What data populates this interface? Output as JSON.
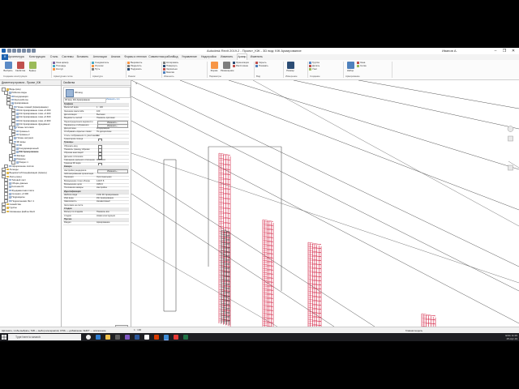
{
  "window": {
    "title": "Autodesk Revit 2019.2 - Проект_KЖ - 3D вид: КЖ Армирование",
    "user": "Иванов А.",
    "controls": [
      "–",
      "❐",
      "✕"
    ]
  },
  "ribbon_tabs": [
    "R",
    "Архитектура",
    "Конструкция",
    "Сталь",
    "Системы",
    "Вставить",
    "Аннотации",
    "Анализ",
    "Формы и генплан",
    "Совместная работа",
    "Вид",
    "Управление",
    "Надстройки",
    "Изменить",
    "Армир.",
    "Изменить"
  ],
  "ribbon_active_tab_index": 14,
  "ribbon": {
    "panels": [
      {
        "name": "Создание конструкции",
        "big": [
          "Выбрать",
          "Свойства",
          "Буфер"
        ]
      },
      {
        "name": "Арматурная сетка",
        "small": [
          "Зона армир.",
          "Площадь",
          "Контур"
        ]
      },
      {
        "name": "Арматура",
        "small": [
          "Соединитель",
          "Отрезок",
          "Путь"
        ]
      },
      {
        "name": "Режим",
        "small": [
          "Выровнять",
          "Разделить",
          "Подрезать"
        ]
      },
      {
        "name": "Изменить",
        "small": [
          "Копировать",
          "Повернуть",
          "Зеркально",
          "Массив"
        ]
      },
      {
        "name": "Параметры",
        "big": [
          "Форма",
          "Размещение"
        ],
        "small": [
          "Ориентация",
          "Расстояние"
        ]
      },
      {
        "name": "Вид",
        "small": [
          "Скрыть",
          "Показать"
        ]
      },
      {
        "name": "Измерение",
        "big": [
          "Размер"
        ]
      },
      {
        "name": "Создание",
        "small": [
          "Группа",
          "Деталь",
          "Узел"
        ]
      },
      {
        "name": "Армирование",
        "big": [
          "Набор"
        ],
        "small": [
          "Зона",
          "Сетка"
        ]
      }
    ]
  },
  "browser": {
    "title": "Диспетчер проекта - Проект_KЖ",
    "items": [
      {
        "label": "Виды (все)",
        "level": 0
      },
      {
        "label": "Рабочие виды",
        "level": 1
      },
      {
        "label": "Координация",
        "level": 2
      },
      {
        "label": "Железобетон",
        "level": 2
      },
      {
        "label": "Армирование",
        "level": 2
      },
      {
        "label": "Планы этажей (Армирование)",
        "level": 3
      },
      {
        "label": "КЖ Армирование этаж +0.000",
        "level": 4
      },
      {
        "label": "КЖ Армирование этаж +3.300",
        "level": 4
      },
      {
        "label": "КЖ Армирование этаж +6.600",
        "level": 4
      },
      {
        "label": "КЖ Армирование этаж +9.900",
        "level": 4
      },
      {
        "label": "КЖ Армирование фундамент",
        "level": 4
      },
      {
        "label": "Планы потолков",
        "level": 3
      },
      {
        "label": "Уровень 1",
        "level": 4
      },
      {
        "label": "Уровень 2",
        "level": 4
      },
      {
        "label": "Планы несущих",
        "level": 3
      },
      {
        "label": "3D виды",
        "level": 3
      },
      {
        "label": "3D",
        "level": 4
      },
      {
        "label": "Координационный",
        "level": 4
      },
      {
        "label": "КЖ Армирование",
        "level": 4,
        "selected": true
      },
      {
        "label": "Фасады",
        "level": 3
      },
      {
        "label": "Разрезы",
        "level": 3
      },
      {
        "label": "Разрез 1",
        "level": 4
      },
      {
        "label": "Оформление листов",
        "level": 1
      },
      {
        "label": "Легенды",
        "level": 0
      },
      {
        "label": "Ведомости/Спецификации (Армир.)",
        "level": 0
      },
      {
        "label": "Листы (все)",
        "level": 0
      },
      {
        "label": "Типовой лист",
        "level": 1
      },
      {
        "label": "Общие данные",
        "level": 1
      },
      {
        "label": "Колонна К1",
        "level": 1
      },
      {
        "label": "Фундаментная плита",
        "level": 1
      },
      {
        "label": "Сечения +3.300",
        "level": 1
      },
      {
        "label": "Подразделы",
        "level": 1
      },
      {
        "label": "Подколонники Лист 1",
        "level": 1
      },
      {
        "label": "Семейства",
        "level": 0
      },
      {
        "label": "Группы",
        "level": 0
      },
      {
        "label": "Связанные файлы Revit",
        "level": 0
      }
    ]
  },
  "properties": {
    "title": "Свойства",
    "type_icon": "3D-view-icon",
    "type_name": "3D вид",
    "type_dropdown": "3D вид: КЖ Армирование",
    "edit_type": "Изменить тип",
    "rows": [
      {
        "k": "Графика",
        "v": "",
        "section": true
      },
      {
        "k": "Масштаб вида",
        "v": "1 : 100"
      },
      {
        "k": "Значение масштаба",
        "v": "100"
      },
      {
        "k": "Детализация",
        "v": "Высокая"
      },
      {
        "k": "Видимость частей",
        "v": "Показать оригинал"
      },
      {
        "k": "Переопределения видимости",
        "v": "Изменить...",
        "button": true
      },
      {
        "k": "Параметры отображения",
        "v": "Изменить...",
        "button": true
      },
      {
        "k": "Дисциплина",
        "v": "Координация"
      },
      {
        "k": "Отображать скрытые линии",
        "v": "По дисциплине"
      },
      {
        "k": "Стиль отображения по умолчанию",
        "v": "Нет"
      },
      {
        "k": "Траектория солнца",
        "v": "",
        "checkbox": true
      },
      {
        "k": "Границы",
        "v": "",
        "section": true
      },
      {
        "k": "Обрезать вид",
        "v": "",
        "checkbox": true
      },
      {
        "k": "Показать границу обрезки",
        "v": "",
        "checkbox": true
      },
      {
        "k": "Обрезка аннотаций",
        "v": "",
        "checkbox": true
      },
      {
        "k": "Дальнее отсечение",
        "v": "",
        "checkbox": true
      },
      {
        "k": "Смещение дальнего отсечения",
        "v": "304800.0"
      },
      {
        "k": "Граница 3D вида",
        "v": "",
        "checkbox": true
      },
      {
        "k": "Камера",
        "v": "",
        "section": true
      },
      {
        "k": "Настройки рендеринга",
        "v": "Изменить...",
        "button": true
      },
      {
        "k": "Заблокированная ориентация",
        "v": ""
      },
      {
        "k": "Проекция",
        "v": "Ортогональная"
      },
      {
        "k": "Возвышение точки обзора",
        "v": "14167.8"
      },
      {
        "k": "Возвышение цели",
        "v": "4950.0"
      },
      {
        "k": "Положение камеры",
        "v": "Настройка"
      },
      {
        "k": "Идентификация",
        "v": "",
        "section": true
      },
      {
        "k": "Шаблон вида",
        "v": "3 КЖ 3D Армирование"
      },
      {
        "k": "Имя вида",
        "v": "КЖ Армирование"
      },
      {
        "k": "Зависимость",
        "v": "Независимый"
      },
      {
        "k": "Заголовок на листе",
        "v": ""
      },
      {
        "k": "Стадии",
        "v": "",
        "section": true
      },
      {
        "k": "Фильтр по стадиям",
        "v": "Показать все"
      },
      {
        "k": "Стадия",
        "v": "Новая конструкция"
      },
      {
        "k": "Прочее",
        "v": "",
        "section": true
      },
      {
        "k": "Раздел",
        "v": "Армирование"
      }
    ],
    "help_link": "Справка по свойствам",
    "apply": "Применить"
  },
  "view": {
    "tab_label": "КЖ Армирование",
    "close": "✕",
    "scale_label": "1 : 100"
  },
  "status": {
    "hint": "Щёлкните, чтобы выбрать; TAB — выбор альтернатив; CTRL — добавление; SHIFT — исключение.",
    "scale": "1 : 100",
    "model": "Главная модель"
  },
  "taskbar": {
    "search_placeholder": "Type here to search",
    "time": "11:29",
    "date": "25-Apr-19",
    "lang": "ENG"
  },
  "colors": {
    "rebar": "#d11a3c",
    "concrete_line": "#555555",
    "accent": "#1b62b0"
  }
}
